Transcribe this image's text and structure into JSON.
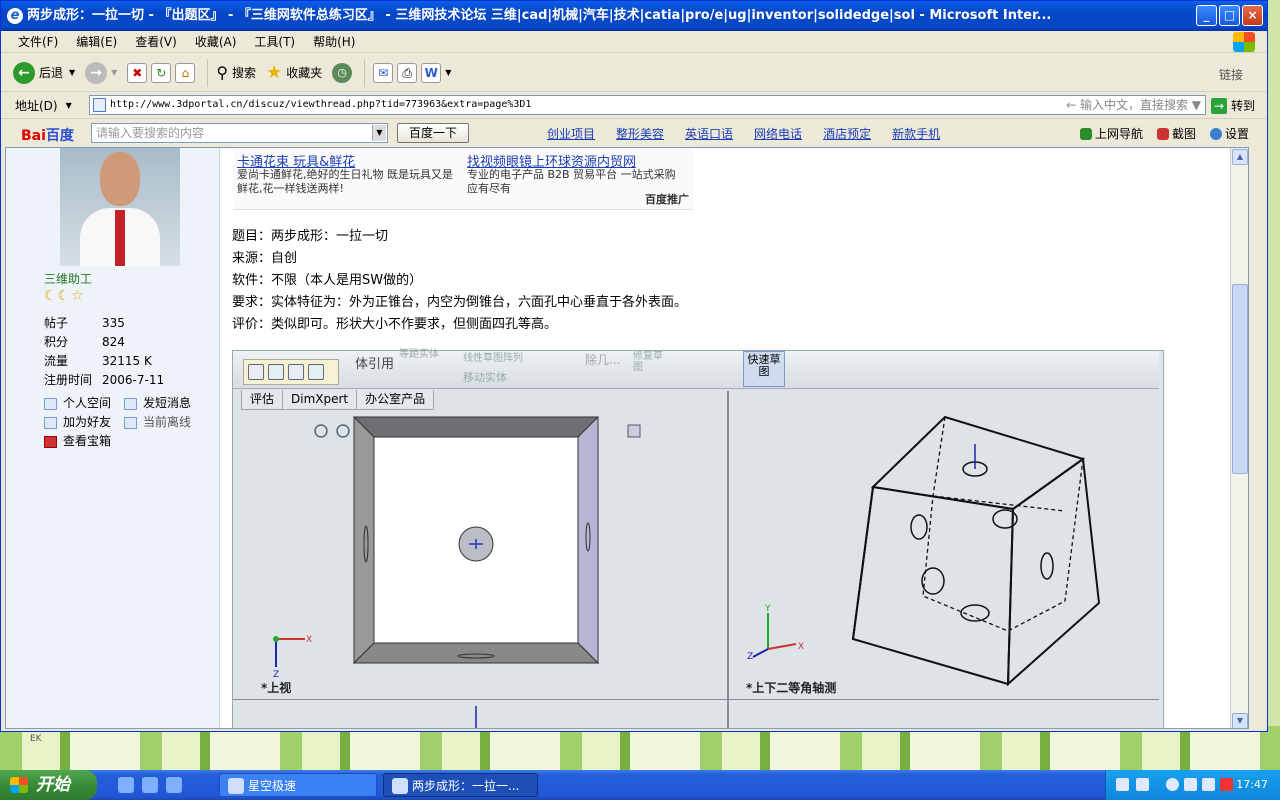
{
  "window": {
    "title": "两步成形：一拉一切 - 『出题区』 - 『三维网软件总练习区』 - 三维网技术论坛 三维|cad|机械|汽车|技术|catia|pro/e|ug|inventor|solidedge|sol - Microsoft Inter...",
    "buttons": [
      "_",
      "□",
      "×"
    ]
  },
  "menu": [
    "文件(F)",
    "编辑(E)",
    "查看(V)",
    "收藏(A)",
    "工具(T)",
    "帮助(H)"
  ],
  "toolbar": {
    "back": "后退",
    "search": "搜索",
    "favorites": "收藏夹",
    "links": "链接"
  },
  "address": {
    "label": "地址(D)",
    "url": "http://www.3dportal.cn/discuz/viewthread.php?tid=773963&extra=page%3D1",
    "hint": "输入中文，直接搜索",
    "go": "转到"
  },
  "baidu": {
    "logo_a": "Bai",
    "logo_b": "百度",
    "placeholder": "请输入要搜索的内容",
    "button": "百度一下",
    "links": [
      "创业项目",
      "整形美容",
      "英语口语",
      "网络电话",
      "酒店预定",
      "新款手机"
    ],
    "right": [
      "上网导航",
      "截图",
      "设置"
    ]
  },
  "user": {
    "name": "三维助工",
    "stars": "☾☾☆",
    "stats": [
      {
        "k": "帖子",
        "v": "335"
      },
      {
        "k": "积分",
        "v": "824"
      },
      {
        "k": "流量",
        "v": "32115 K"
      },
      {
        "k": "注册时间",
        "v": "2006-7-11"
      }
    ],
    "actions": [
      "个人空间",
      "发短消息",
      "加为好友",
      "当前离线",
      "查看宝箱"
    ]
  },
  "ad": {
    "t1": "卡通花束 玩具&鲜花",
    "d1": "爱尚卡通鲜花,绝好的生日礼物 既是玩具又是鲜花,花一样钱送两样!",
    "t2": "找视频眼镜上环球资源内贸网",
    "d2": "专业的电子产品 B2B 贸易平台 一站式采购 应有尽有",
    "tag": "百度推广"
  },
  "post": [
    "题目：两步成形：一拉一切",
    "来源：自创",
    "软件：不限（本人是用SW做的）",
    "要求：实体特征为：外为正锥台，内空为倒锥台，六面孔中心垂直于各外表面。",
    "评价：类似即可。形状大小不作要求，但侧面四孔等高。"
  ],
  "cad": {
    "ribbon": [
      "体引用",
      "等距实体",
      "线性草图阵列",
      "移动实体",
      "除几...",
      "修复草图",
      "快速草图"
    ],
    "tabs": [
      "评估",
      "DimXpert",
      "办公室产品"
    ],
    "view_left": "*上视",
    "view_right": "*上下二等角轴测",
    "axis": {
      "x": "X",
      "y": "Y",
      "z": "Z"
    }
  },
  "taskbar": {
    "start": "开始",
    "tasks": [
      "星空极速",
      "两步成形：一拉一..."
    ],
    "clock": "17:47"
  },
  "desktop_label": "EK"
}
